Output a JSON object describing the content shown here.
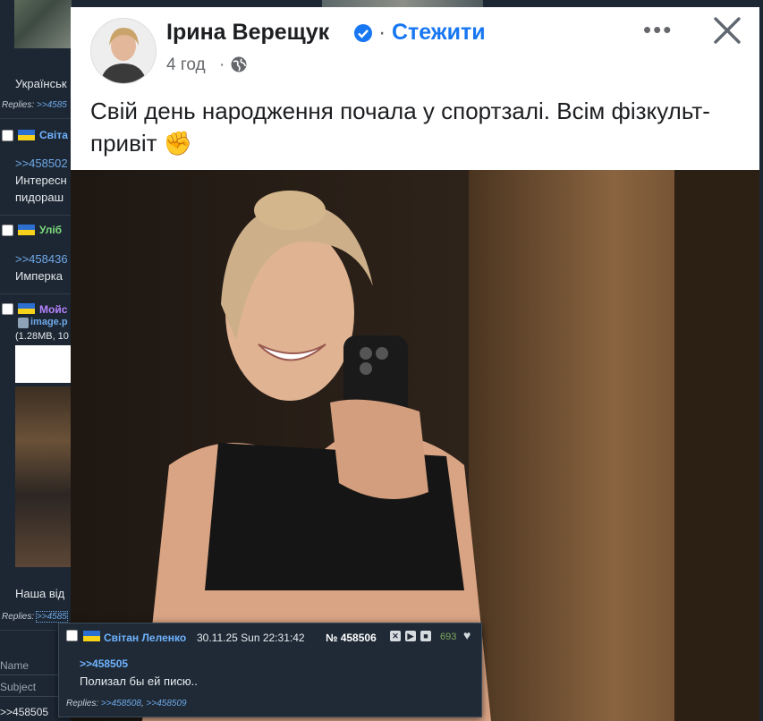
{
  "thread": {
    "post1_text": "Українськ",
    "post1_replies_label": "Replies:",
    "post1_replies_link": ">>4585",
    "post2_name": "Світа",
    "post2_quote": ">>458502",
    "post2_line1": "Интересн",
    "post2_line2": "пидораш",
    "post3_name": "Уліб",
    "post3_quote": ">>458436",
    "post3_line1": "Имперка",
    "post4_name": "Мойс",
    "post4_file": "image.p",
    "post4_fileinfo": "(1.28MB, 10",
    "post4_text": "Наша від",
    "post4_replies_label": "Replies:",
    "post4_replies_link": ">>4585",
    "form_name_label": "Name",
    "form_subject_label": "Subject",
    "form_comment_value": ">>458505",
    "colors": {
      "background": "#1d2733",
      "link": "#6fa8e8"
    }
  },
  "facebook_post": {
    "author": "Ірина Верещук",
    "follow_label": "Стежити",
    "time": "4 год",
    "text": "Свій день народження почала у спортзалі. Всім фізкульт-привіт",
    "emoji": "✊",
    "more_icon": "ellipsis-icon",
    "close_icon": "close-icon"
  },
  "hover_reply": {
    "name": "Світан Леленко",
    "date": "30.11.25 Sun 22:31:42",
    "number": "№ 458506",
    "count": "693",
    "quote": ">>458505",
    "body": "Полизал бы ей писю..",
    "replies_label": "Replies:",
    "reply_link_1": ">>458508",
    "reply_link_2": ">>458509"
  }
}
